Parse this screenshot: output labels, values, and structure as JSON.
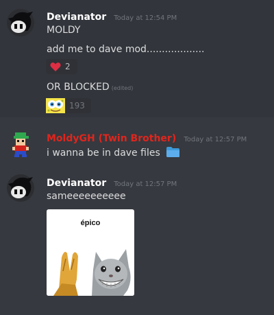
{
  "messages": [
    {
      "author": "Devianator",
      "timestamp": "Today at 12:54 PM",
      "lines": [
        {
          "text": "MOLDY"
        },
        {
          "text": "add me to dave mod..................."
        },
        {
          "text": "OR BLOCKED",
          "edited": "(edited)"
        }
      ],
      "reactions": [
        {
          "emoji": "heart-emoji",
          "count": "2"
        },
        {
          "emoji": "spongebob-emoji",
          "count": "193"
        }
      ]
    },
    {
      "author": "MoldyGH (Twin Brother)",
      "author_color": "#e0251d",
      "timestamp": "Today at 12:57 PM",
      "lines": [
        {
          "text": "i wanna be in dave files",
          "emoji": "folder-emoji"
        }
      ]
    },
    {
      "author": "Devianator",
      "timestamp": "Today at 12:57 PM",
      "lines": [
        {
          "text": "sameeeeeeeeee"
        }
      ],
      "attachment": {
        "caption": "épico",
        "image": "praying-hands-cat-meme"
      }
    }
  ],
  "colors": {
    "background": "#36393f",
    "hover_background": "#32353b",
    "reaction_background": "#2f3136",
    "timestamp": "#72767d"
  }
}
